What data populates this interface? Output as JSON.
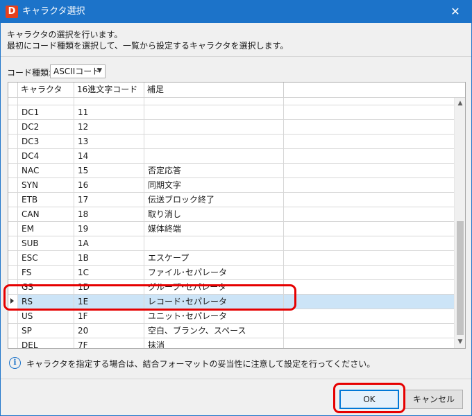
{
  "window": {
    "app_icon_letter": "D",
    "title": "キャラクタ選択",
    "close_glyph": "✕"
  },
  "description": {
    "line1": "キャラクタの選択を行います。",
    "line2": "最初にコード種類を選択して、一覧から設定するキャラクタを選択します。"
  },
  "code_type": {
    "label": "コード種類:",
    "selected": "ASCIIコード"
  },
  "grid": {
    "columns": [
      "キャラクタ",
      "16進文字コード",
      "補足"
    ],
    "rows": [
      {
        "char": "",
        "hex": "",
        "note": ""
      },
      {
        "char": "DC1",
        "hex": "11",
        "note": ""
      },
      {
        "char": "DC2",
        "hex": "12",
        "note": ""
      },
      {
        "char": "DC3",
        "hex": "13",
        "note": ""
      },
      {
        "char": "DC4",
        "hex": "14",
        "note": ""
      },
      {
        "char": "NAC",
        "hex": "15",
        "note": "否定応答"
      },
      {
        "char": "SYN",
        "hex": "16",
        "note": "同期文字"
      },
      {
        "char": "ETB",
        "hex": "17",
        "note": "伝送ブロック終了"
      },
      {
        "char": "CAN",
        "hex": "18",
        "note": "取り消し"
      },
      {
        "char": "EM",
        "hex": "19",
        "note": "媒体終端"
      },
      {
        "char": "SUB",
        "hex": "1A",
        "note": ""
      },
      {
        "char": "ESC",
        "hex": "1B",
        "note": "エスケープ"
      },
      {
        "char": "FS",
        "hex": "1C",
        "note": "ファイル･セパレータ"
      },
      {
        "char": "GS",
        "hex": "1D",
        "note": "グループ･セパレータ"
      },
      {
        "char": "RS",
        "hex": "1E",
        "note": "レコード･セパレータ",
        "selected": true
      },
      {
        "char": "US",
        "hex": "1F",
        "note": "ユニット･セパレータ"
      },
      {
        "char": "SP",
        "hex": "20",
        "note": "空白、ブランク、スペース"
      },
      {
        "char": "DEL",
        "hex": "7F",
        "note": "抹消"
      }
    ],
    "scroll_up_glyph": "▲",
    "scroll_down_glyph": "▼"
  },
  "info": {
    "icon_glyph": "i",
    "text": "キャラクタを指定する場合は、結合フォーマットの妥当性に注意して設定を行ってください。"
  },
  "buttons": {
    "ok": "OK",
    "cancel": "キャンセル"
  },
  "colors": {
    "titlebar": "#1c73c9",
    "selection": "#cce4f7",
    "highlight": "#e60000",
    "ok_border": "#0078d7"
  }
}
